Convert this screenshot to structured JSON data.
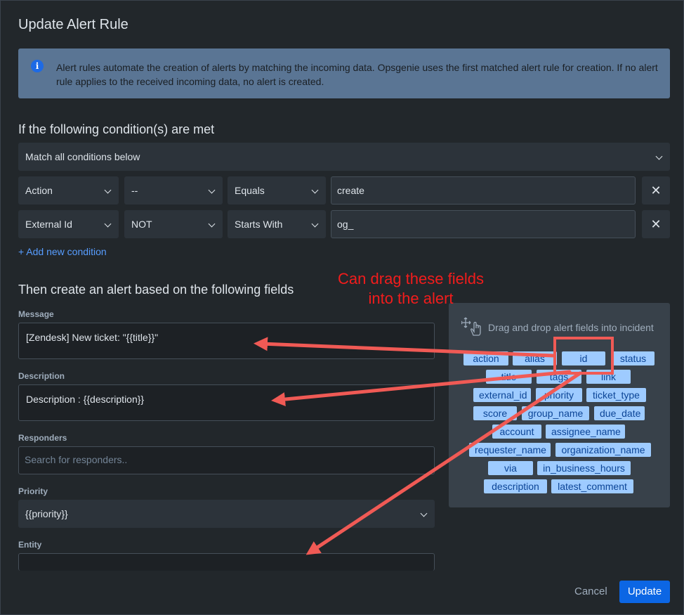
{
  "dialog": {
    "title": "Update Alert Rule",
    "info_text": "Alert rules automate the creation of alerts by matching the incoming data. Opsgenie uses the first matched alert rule for creation. If no alert rule applies to the received incoming data, no alert is created.",
    "info_icon": "i",
    "conditions_heading": "If the following condition(s) are met",
    "match_mode": "Match all conditions below",
    "conditions": [
      {
        "field": "Action",
        "negate": "--",
        "operator": "Equals",
        "value": "create",
        "remove": "✕"
      },
      {
        "field": "External Id",
        "negate": "NOT",
        "operator": "Starts With",
        "value": "og_",
        "remove": "✕"
      }
    ],
    "add_condition": "+ Add new condition",
    "fields_heading": "Then create an alert based on the following fields",
    "message_label": "Message",
    "message_value": "[Zendesk] New ticket: \"{{title}}\"",
    "description_label": "Description",
    "description_value": "Description : {{description}}",
    "responders_label": "Responders",
    "responders_placeholder": "Search for responders..",
    "priority_label": "Priority",
    "priority_value": "{{priority}}",
    "entity_label": "Entity",
    "entity_value": "",
    "cancel_label": "Cancel",
    "update_label": "Update"
  },
  "drag_panel": {
    "hint": "Drag and drop alert fields into incident",
    "chips": [
      "action",
      "alias",
      "id",
      "status",
      "title",
      "tags",
      "link",
      "external_id",
      "priority",
      "ticket_type",
      "score",
      "group_name",
      "due_date",
      "account",
      "assignee_name",
      "requester_name",
      "organization_name",
      "via",
      "in_business_hours",
      "description",
      "latest_comment"
    ]
  },
  "annotation": {
    "line1": "Can drag these  fields",
    "line2": "into the alert",
    "color": "#f21c1c"
  },
  "colors": {
    "primary_button": "#0c66e4",
    "chip_bg": "#9ecbff",
    "link": "#579dff"
  }
}
